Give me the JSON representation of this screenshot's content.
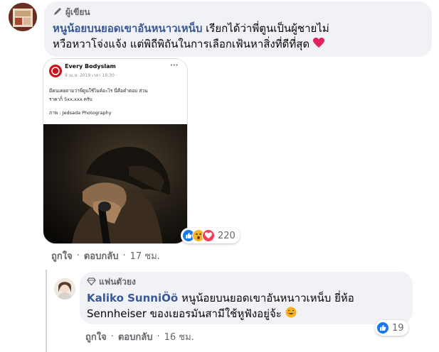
{
  "comment1": {
    "badge_label": "ผู้เขียน",
    "author": "หนูน้อยบนยอดเขาอันหนาวเหน็บ",
    "text_line1": "เรียกได้ว่าพี่ตูนเป็นผู้ชายไม่",
    "text_line2": "หวือหวาโจ่งแจ้ง แต่พิถีพิถันในการเลือกเฟ้นหาสิ่งที่ดีที่สุด",
    "reaction_count": "220",
    "actions": {
      "like": "ถูกใจ",
      "reply": "ตอบกลับ",
      "time": "17 ชม."
    }
  },
  "shared_post": {
    "page_name": "Every Bodyslam",
    "date": "9 เม.ย. 2019 เวลา 16:30 ·",
    "more": "···",
    "text_line1": "มีคนเคยถามว่าพี่ตูนใช้ไมค์อะไร นี่คือคำตอบ ส่วน",
    "text_line2": "ราคาก็ 5xx,xxx ครับ",
    "credit": "ภาพ : Jedsada Photography"
  },
  "comment2": {
    "badge_label": "แฟนตัวยง",
    "author": "Kaliko SunniÖö",
    "mention": "หนูน้อยบนยอดเขาอันหนาวเหน็บ",
    "text_line1_rest": "ยี่ห้อ",
    "text_line2": "Sennheiser ของเยอรมันสามีใช้หูฟังอยู่จ้ะ",
    "reaction_count": "19",
    "actions": {
      "like": "ถูกใจ",
      "reply": "ตอบกลับ",
      "time": "16 ชม."
    }
  },
  "colors": {
    "link": "#385898",
    "bubble": "#f0f2f5",
    "like_blue": "#1877f2",
    "love_red": "#f33e58",
    "haha_yellow": "#f7b125"
  }
}
